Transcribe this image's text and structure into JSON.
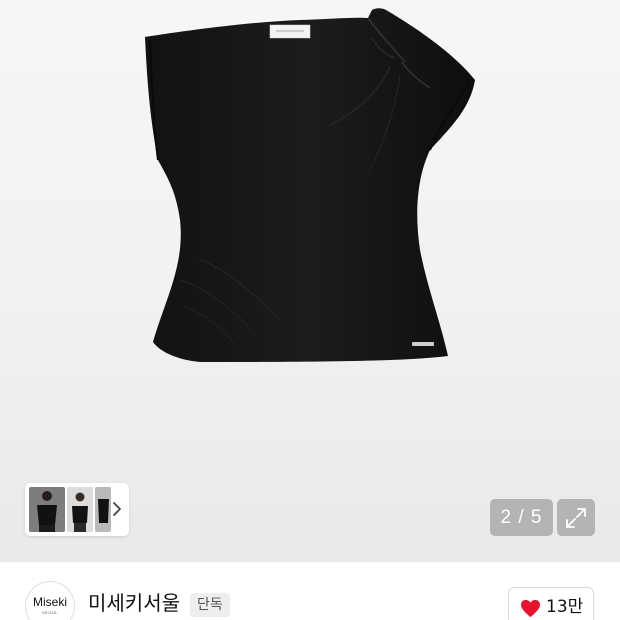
{
  "product": {
    "image_alt": "black one-shoulder sleeveless draped top",
    "image_index": "2 / 5"
  },
  "gallery": {
    "thumbnail_count": 3,
    "next_icon": "chevron-right-icon",
    "expand_icon": "expand-icon"
  },
  "store": {
    "logo_text": "Miseki",
    "logo_subtext": "SEOUL",
    "name": "미세키서울",
    "badge": "단독"
  },
  "like": {
    "icon": "heart-icon",
    "count": "13만",
    "color": "#e8132b"
  }
}
